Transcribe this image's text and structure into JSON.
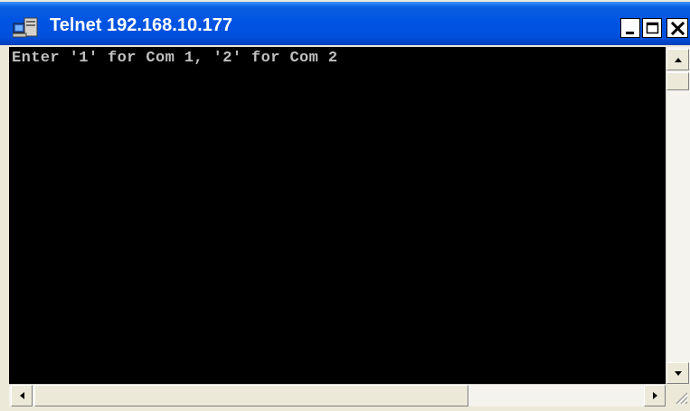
{
  "window": {
    "title": "Telnet 192.168.10.177",
    "icons": {
      "app": "telnet-computer-icon",
      "minimize": "minimize-icon",
      "maximize": "maximize-icon",
      "close": "close-icon"
    }
  },
  "console": {
    "lines": [
      "Enter '1' for Com 1, '2' for Com 2"
    ]
  },
  "scrollbars": {
    "vertical": {
      "up": "arrow-up-icon",
      "down": "arrow-down-icon"
    },
    "horizontal": {
      "left": "arrow-left-icon",
      "right": "arrow-right-icon"
    }
  },
  "colors": {
    "titlebar": "#0054e3",
    "console_bg": "#000000",
    "console_text": "#c0c0c0"
  }
}
